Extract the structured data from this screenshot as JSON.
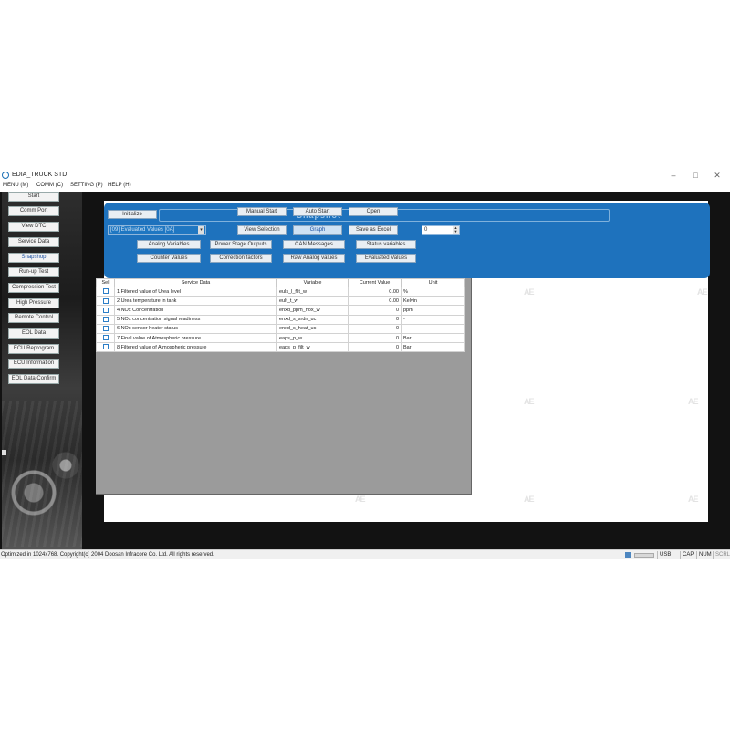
{
  "window": {
    "title": "EDIA_TRUCK STD",
    "controls": [
      "–",
      "□",
      "✕"
    ]
  },
  "menu": [
    "MENU (M)",
    "COMM (C)",
    "SETTING (P)",
    "HELP (H)"
  ],
  "sidebar": {
    "items": [
      {
        "label": "Start"
      },
      {
        "label": "Comm Port"
      },
      {
        "label": "View DTC"
      },
      {
        "label": "Service Data"
      },
      {
        "label": "Snapshop"
      },
      {
        "label": "Run-up Test"
      },
      {
        "label": "Compression Test"
      },
      {
        "label": "High Pressure"
      },
      {
        "label": "Remote Control"
      },
      {
        "label": "EOL Data"
      },
      {
        "label": "ECU Reprogram"
      },
      {
        "label": "ECU Information"
      },
      {
        "label": "EOL Data Confirm"
      }
    ]
  },
  "toolbar": {
    "initialize": "Initialize",
    "manual_start": "Manual Start",
    "auto_start": "Auto Start",
    "open": "Open",
    "view_selection": "View Selection",
    "graph": "Graph",
    "save_excel": "Save as Excel",
    "value_select": "[09] Evaluated Values [0A]",
    "spin_value": "0",
    "ghost_title": "Snapshot"
  },
  "categories": {
    "analog": "Analog Variables",
    "power_stage": "Power Stage Outputs",
    "can": "CAN Messages",
    "status": "Status variables",
    "counter": "Counter Values",
    "correction": "Correction factors",
    "raw_analog": "Raw Analog values",
    "evaluated": "Evaluated Values"
  },
  "table": {
    "headers": {
      "sel": "Sel",
      "service": "Service Data",
      "variable": "Variable",
      "current": "Current Value",
      "unit": "Unit"
    },
    "rows": [
      {
        "service": "1.Filtered value of Urea level",
        "variable": "euls_l_filt_w",
        "value": "0.00",
        "unit": "%"
      },
      {
        "service": "2.Urea temperature in tank",
        "variable": "eult_t_w",
        "value": "0.00",
        "unit": "Kelvin"
      },
      {
        "service": "4.NOx Concentration",
        "variable": "enxd_ppm_nox_w",
        "value": "0",
        "unit": "ppm"
      },
      {
        "service": "5.NOx concentration signal readiness",
        "variable": "enxd_s_srdn_uc",
        "value": "0",
        "unit": "-"
      },
      {
        "service": "6.NOx sensor heater status",
        "variable": "enxd_s_heat_uc",
        "value": "0",
        "unit": "-"
      },
      {
        "service": "7.Final value of Atmospheric pressure",
        "variable": "eaps_p_w",
        "value": "0",
        "unit": "Bar"
      },
      {
        "service": "8.Filtered value of Atmospheric pressure",
        "variable": "eaps_p_filt_w",
        "value": "0",
        "unit": "Bar"
      }
    ]
  },
  "statusbar": {
    "message": "Optimized in 1024x768. Copyright(c) 2004 Doosan Infracore Co. Ltd. All rights reserved.",
    "usb": "USB",
    "cap": "CAP",
    "num": "NUM",
    "scrl": "SCRL"
  },
  "watermark": "AE",
  "colors": {
    "panel_blue": "#1e72bd",
    "frame": "#121212",
    "data_area": "#9b9b9b"
  }
}
